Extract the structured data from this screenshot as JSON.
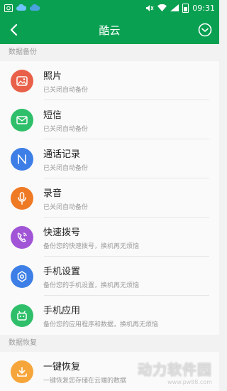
{
  "status_bar": {
    "time": "09:31",
    "icons": [
      "screenshot-icon",
      "cloud-icon",
      "cloud-icon",
      "mute-icon",
      "wifi-icon",
      "signal-icon",
      "battery-icon"
    ]
  },
  "app_bar": {
    "title": "酷云",
    "back_icon": "back-arrow-icon",
    "menu_icon": "chevron-down-circle-icon"
  },
  "sections": [
    {
      "header": "数据备份",
      "items": [
        {
          "label": "照片",
          "sub": "已关闭自动备份",
          "icon": "photo-icon",
          "color": "#e9604a"
        },
        {
          "label": "短信",
          "sub": "已关闭自动备份",
          "icon": "mail-icon",
          "color": "#2fbf6a"
        },
        {
          "label": "通话记录",
          "sub": "已关闭自动备份",
          "icon": "call-log-icon",
          "color": "#3d7fe6"
        },
        {
          "label": "录音",
          "sub": "已关闭自动备份",
          "icon": "microphone-icon",
          "color": "#ef7a25"
        },
        {
          "label": "快速拨号",
          "sub": "备份您的快速拨号，换机再无烦恼",
          "icon": "speed-dial-icon",
          "color": "#a155d6"
        },
        {
          "label": "手机设置",
          "sub": "备份您的手机设置，换机再无烦恼",
          "icon": "settings-gear-icon",
          "color": "#3d7fe6"
        },
        {
          "label": "手机应用",
          "sub": "备份您的应用程序和数据，换机再无烦恼",
          "icon": "android-app-icon",
          "color": "#2fbf6a"
        }
      ]
    },
    {
      "header": "数据恢复",
      "items": [
        {
          "label": "一键恢复",
          "sub": "一键恢复您存储在云端的数据",
          "icon": "download-restore-icon",
          "color": "#f6a53a"
        }
      ]
    }
  ],
  "watermark": {
    "text": "动力软件园",
    "url": "www.pw88.com"
  }
}
